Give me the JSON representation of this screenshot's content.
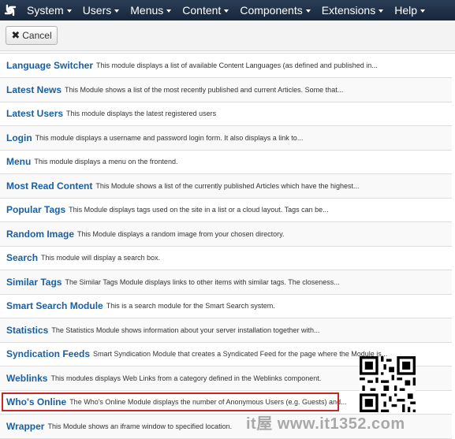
{
  "navbar": {
    "logo_icon": "joomla-logo-icon",
    "menus": [
      "System",
      "Users",
      "Menus",
      "Content",
      "Components",
      "Extensions",
      "Help"
    ]
  },
  "toolbar": {
    "cancel_label": "Cancel",
    "cancel_icon": "close-icon"
  },
  "modules": [
    {
      "title": "Language Switcher",
      "description": "This module displays a list of available Content Languages (as defined and published in..."
    },
    {
      "title": "Latest News",
      "description": "This Module shows a list of the most recently published and current Articles. Some that..."
    },
    {
      "title": "Latest Users",
      "description": "This module displays the latest registered users"
    },
    {
      "title": "Login",
      "description": "This module displays a username and password login form. It also displays a link to..."
    },
    {
      "title": "Menu",
      "description": "This module displays a menu on the frontend."
    },
    {
      "title": "Most Read Content",
      "description": "This Module shows a list of the currently published Articles which have the highest..."
    },
    {
      "title": "Popular Tags",
      "description": "This Module displays tags used on the site in a list or a cloud layout. Tags can be..."
    },
    {
      "title": "Random Image",
      "description": "This Module displays a random image from your chosen directory."
    },
    {
      "title": "Search",
      "description": "This module will display a search box."
    },
    {
      "title": "Similar Tags",
      "description": "The Similar Tags Module displays links to other items with similar tags. The closeness..."
    },
    {
      "title": "Smart Search Module",
      "description": "This is a search module for the Smart Search system."
    },
    {
      "title": "Statistics",
      "description": "The Statistics Module shows information about your server installation together with..."
    },
    {
      "title": "Syndication Feeds",
      "description": "Smart Syndication Module that creates a Syndicated Feed for the page where the Module is..."
    },
    {
      "title": "Weblinks",
      "description": "This modules displays Web Links from a category defined in the Weblinks component."
    },
    {
      "title": "Who's Online",
      "description": "The Who's Online Module displays the number of Anonymous Users (e.g. Guests) and..."
    },
    {
      "title": "Wrapper",
      "description": "This Module shows an iframe window to specified location."
    }
  ],
  "highlighted_module": "Who's Online",
  "highlight_color": "#c8262b",
  "link_color": "#1a5fa0",
  "watermark": {
    "text": "it屋 www.it1352.com"
  }
}
